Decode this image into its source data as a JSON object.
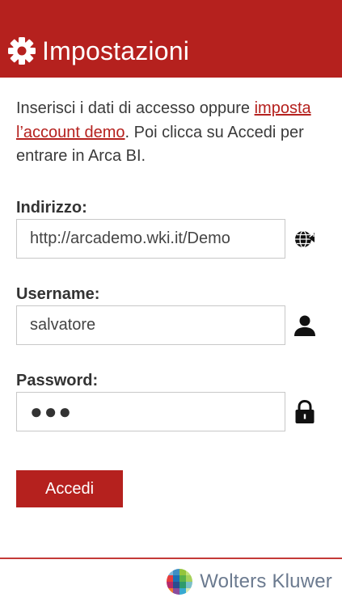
{
  "header": {
    "title": "Impostazioni",
    "icon": "gear-icon"
  },
  "intro": {
    "text_before": "Inserisci i dati di accesso oppure ",
    "link": "imposta l’account demo",
    "text_after": ". Poi clicca su Accedi per entrare in Arca BI."
  },
  "fields": {
    "address": {
      "label": "Indirizzo:",
      "value": "http://arcademo.wki.it/Demo",
      "icon": "globe-icon"
    },
    "username": {
      "label": "Username:",
      "value": "salvatore",
      "icon": "user-icon"
    },
    "password": {
      "label": "Password:",
      "value": "●●●",
      "icon": "lock-icon"
    }
  },
  "login_button": "Accedi",
  "footer": {
    "brand": "Wolters Kluwer",
    "icon": "wolters-kluwer-logo"
  },
  "colors": {
    "accent": "#b5211e",
    "brand_text": "#6b7a8f"
  }
}
